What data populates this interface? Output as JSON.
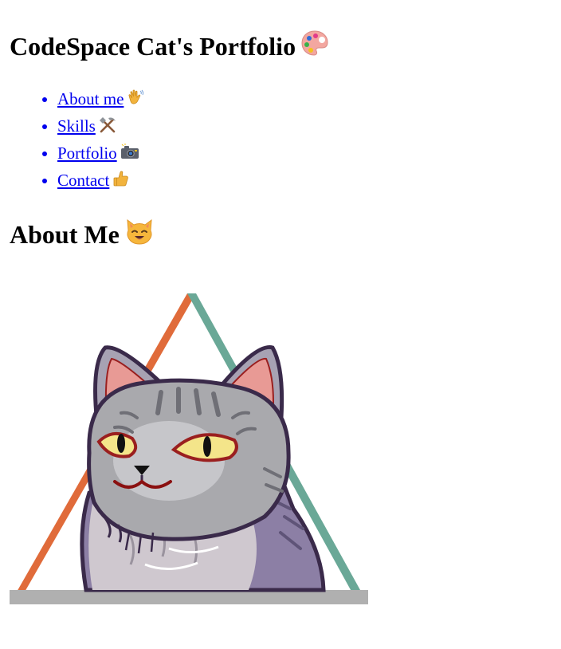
{
  "header": {
    "title": "CodeSpace Cat's Portfolio",
    "title_icon": "palette-icon"
  },
  "nav": {
    "items": [
      {
        "label": "About me",
        "icon": "waving-hand-icon"
      },
      {
        "label": "Skills",
        "icon": "hammer-pick-icon"
      },
      {
        "label": "Portfolio",
        "icon": "camera-icon"
      },
      {
        "label": "Contact",
        "icon": "thumbs-up-icon"
      }
    ]
  },
  "about": {
    "heading": "About Me",
    "heading_icon": "cat-face-icon",
    "image": "cat-portrait-illustration"
  },
  "colors": {
    "link": "#0000ee",
    "triangle_left": "#e06b3a",
    "triangle_right": "#6aa897",
    "triangle_base": "#b0b0b0",
    "cat_fur": "#a9a9ad",
    "cat_outline": "#3a2a4a",
    "cat_eye": "#f4e58a"
  }
}
